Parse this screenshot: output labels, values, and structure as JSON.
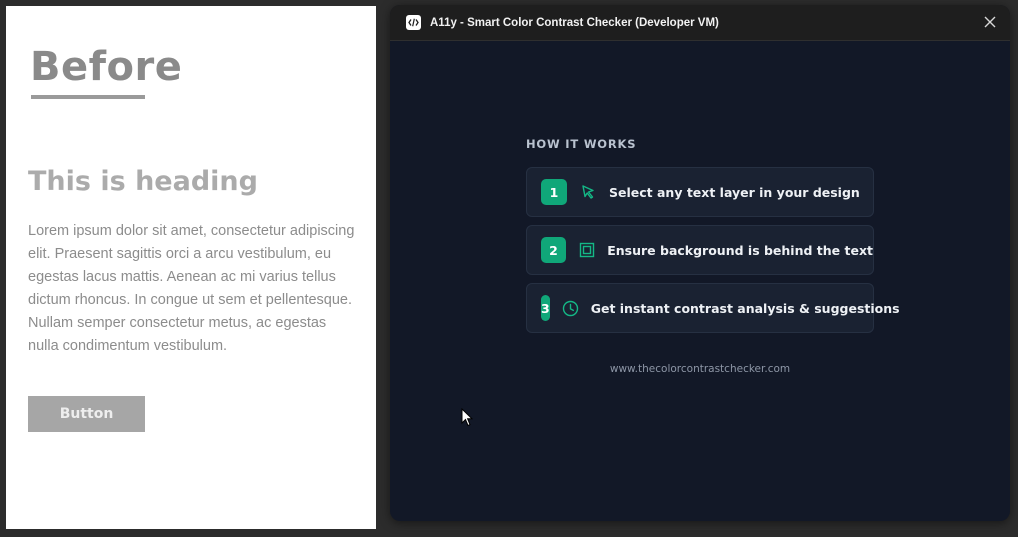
{
  "canvas": {
    "before_title": "Before",
    "heading": "This is heading",
    "body_text": "Lorem ipsum dolor sit amet, consectetur adipiscing elit. Praesent sagittis orci a arcu vestibulum, eu egestas lacus mattis. Aenean ac mi varius tellus dictum rhoncus. In congue ut sem et pellentesque. Nullam semper consectetur metus, ac egestas nulla condimentum vestibulum.",
    "button_label": "Button"
  },
  "plugin": {
    "window_title": "A11y - Smart Color Contrast Checker (Developer VM)",
    "section_title": "HOW IT WORKS",
    "steps": [
      {
        "number": "1",
        "icon": "cursor-pointer-icon",
        "label": "Select any text layer in your design"
      },
      {
        "number": "2",
        "icon": "frame-layer-icon",
        "label": "Ensure background is behind the text"
      },
      {
        "number": "3",
        "icon": "clock-icon",
        "label": "Get instant contrast analysis & suggestions"
      }
    ],
    "footer_link": "www.thecolorcontrastchecker.com",
    "accent_color": "#10a779",
    "background_color": "#121827"
  }
}
